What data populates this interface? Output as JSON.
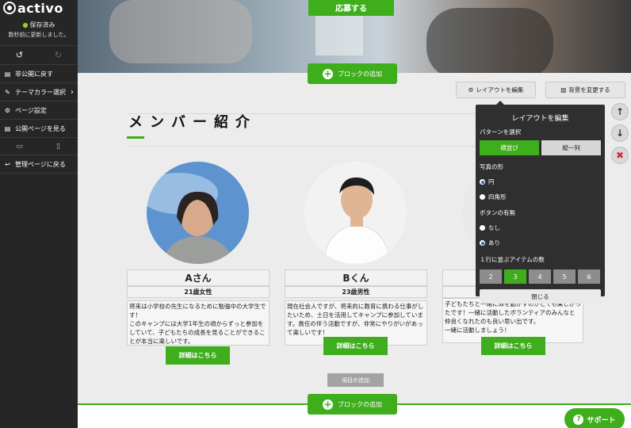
{
  "sidebar": {
    "logo": "activo",
    "save_status": "保存済み",
    "save_sub": "数秒前に更新しました。",
    "items": [
      {
        "label": "非公開に戻す"
      },
      {
        "label": "テーマカラー選択"
      },
      {
        "label": "ページ設定"
      },
      {
        "label": "公開ページを見る"
      },
      {
        "label": "管理ページに戻る"
      }
    ]
  },
  "hero": {
    "apply_label": "応募する"
  },
  "add_block_label": "ブロックの追加",
  "toolbar": {
    "edit_layout": "レイアウトを編集",
    "change_bg": "背景を変更する"
  },
  "section": {
    "title": "メンバー紹介"
  },
  "members": [
    {
      "name": "Aさん",
      "age": "21歳女性",
      "desc": "将来は小学校の先生になるために勉強中の大学生です！\nこのキャンプには大学1年生の頃からずっと参加をしていて、子どもたちの成長を見ることができることが本当に楽しいです。",
      "detail": "詳細はこちら"
    },
    {
      "name": "Bくん",
      "age": "23歳男性",
      "desc": "現在社会人ですが、将来的に教育に携わる仕事がしたいため、土日を活用してキャンプに参加しています。責任の伴う活動ですが、非常にやりがいがあって楽しいです！",
      "detail": "詳細はこちら"
    },
    {
      "name": "",
      "age": "",
      "desc": "子どもたちと一緒に体を動かすのがとても楽しかったです！一緒に活動したボランティアのみんなと仲良くなれたのも良い思い出です。\n一緒に活動しましょう！",
      "detail": "詳細はこちら"
    }
  ],
  "add_item_label": "項目の追加",
  "support_label": "サポート",
  "layout_panel": {
    "title": "レイアウトを編集",
    "pattern_label": "パターンを選択",
    "pattern_options": [
      "横並び",
      "縦一列"
    ],
    "photo_shape_label": "写真の形",
    "photo_shapes": [
      "円",
      "四角形"
    ],
    "button_label": "ボタンの有無",
    "button_options": [
      "なし",
      "あり"
    ],
    "count_label": "１行に並ぶアイテムの数",
    "counts": [
      "2",
      "3",
      "4",
      "5",
      "6"
    ],
    "close_label": "閉じる"
  },
  "colors": {
    "accent": "#3fae1d",
    "sidebar": "#262626",
    "delete": "#d32b2b"
  }
}
